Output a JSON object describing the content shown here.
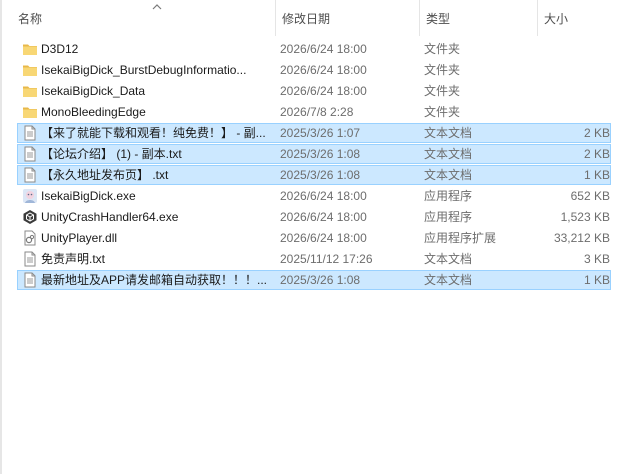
{
  "columns": {
    "name": "名称",
    "date": "修改日期",
    "type": "类型",
    "size": "大小"
  },
  "files": [
    {
      "name": "D3D12",
      "date": "2026/6/24 18:00",
      "type": "文件夹",
      "size": "",
      "icon": "folder-icon",
      "selected": false
    },
    {
      "name": "IsekaiBigDick_BurstDebugInformatio...",
      "date": "2026/6/24 18:00",
      "type": "文件夹",
      "size": "",
      "icon": "folder-icon",
      "selected": false
    },
    {
      "name": "IsekaiBigDick_Data",
      "date": "2026/6/24 18:00",
      "type": "文件夹",
      "size": "",
      "icon": "folder-icon",
      "selected": false
    },
    {
      "name": "MonoBleedingEdge",
      "date": "2026/7/8 2:28",
      "type": "文件夹",
      "size": "",
      "icon": "folder-icon",
      "selected": false
    },
    {
      "name": "【来了就能下载和观看！纯免费！】 - 副...",
      "date": "2025/3/26 1:07",
      "type": "文本文档",
      "size": "2 KB",
      "icon": "text-file-icon",
      "selected": true
    },
    {
      "name": "【论坛介绍】 (1) - 副本.txt",
      "date": "2025/3/26 1:08",
      "type": "文本文档",
      "size": "2 KB",
      "icon": "text-file-icon",
      "selected": true
    },
    {
      "name": "【永久地址发布页】 .txt",
      "date": "2025/3/26 1:08",
      "type": "文本文档",
      "size": "1 KB",
      "icon": "text-file-icon",
      "selected": true
    },
    {
      "name": "IsekaiBigDick.exe",
      "date": "2026/6/24 18:00",
      "type": "应用程序",
      "size": "652 KB",
      "icon": "app-exe-icon",
      "selected": false
    },
    {
      "name": "UnityCrashHandler64.exe",
      "date": "2026/6/24 18:00",
      "type": "应用程序",
      "size": "1,523 KB",
      "icon": "unity-icon",
      "selected": false
    },
    {
      "name": "UnityPlayer.dll",
      "date": "2026/6/24 18:00",
      "type": "应用程序扩展",
      "size": "33,212 KB",
      "icon": "dll-file-icon",
      "selected": false
    },
    {
      "name": "免责声明.txt",
      "date": "2025/11/12 17:26",
      "type": "文本文档",
      "size": "3 KB",
      "icon": "text-file-icon",
      "selected": false
    },
    {
      "name": "最新地址及APP请发邮箱自动获取！！！...",
      "date": "2025/3/26 1:08",
      "type": "文本文档",
      "size": "1 KB",
      "icon": "text-file-icon",
      "selected": true
    }
  ],
  "colors": {
    "selection_bg": "#cce8ff",
    "selection_border": "#99d1ff",
    "folder": "#f8d775",
    "folder_dark": "#e8b84a"
  }
}
